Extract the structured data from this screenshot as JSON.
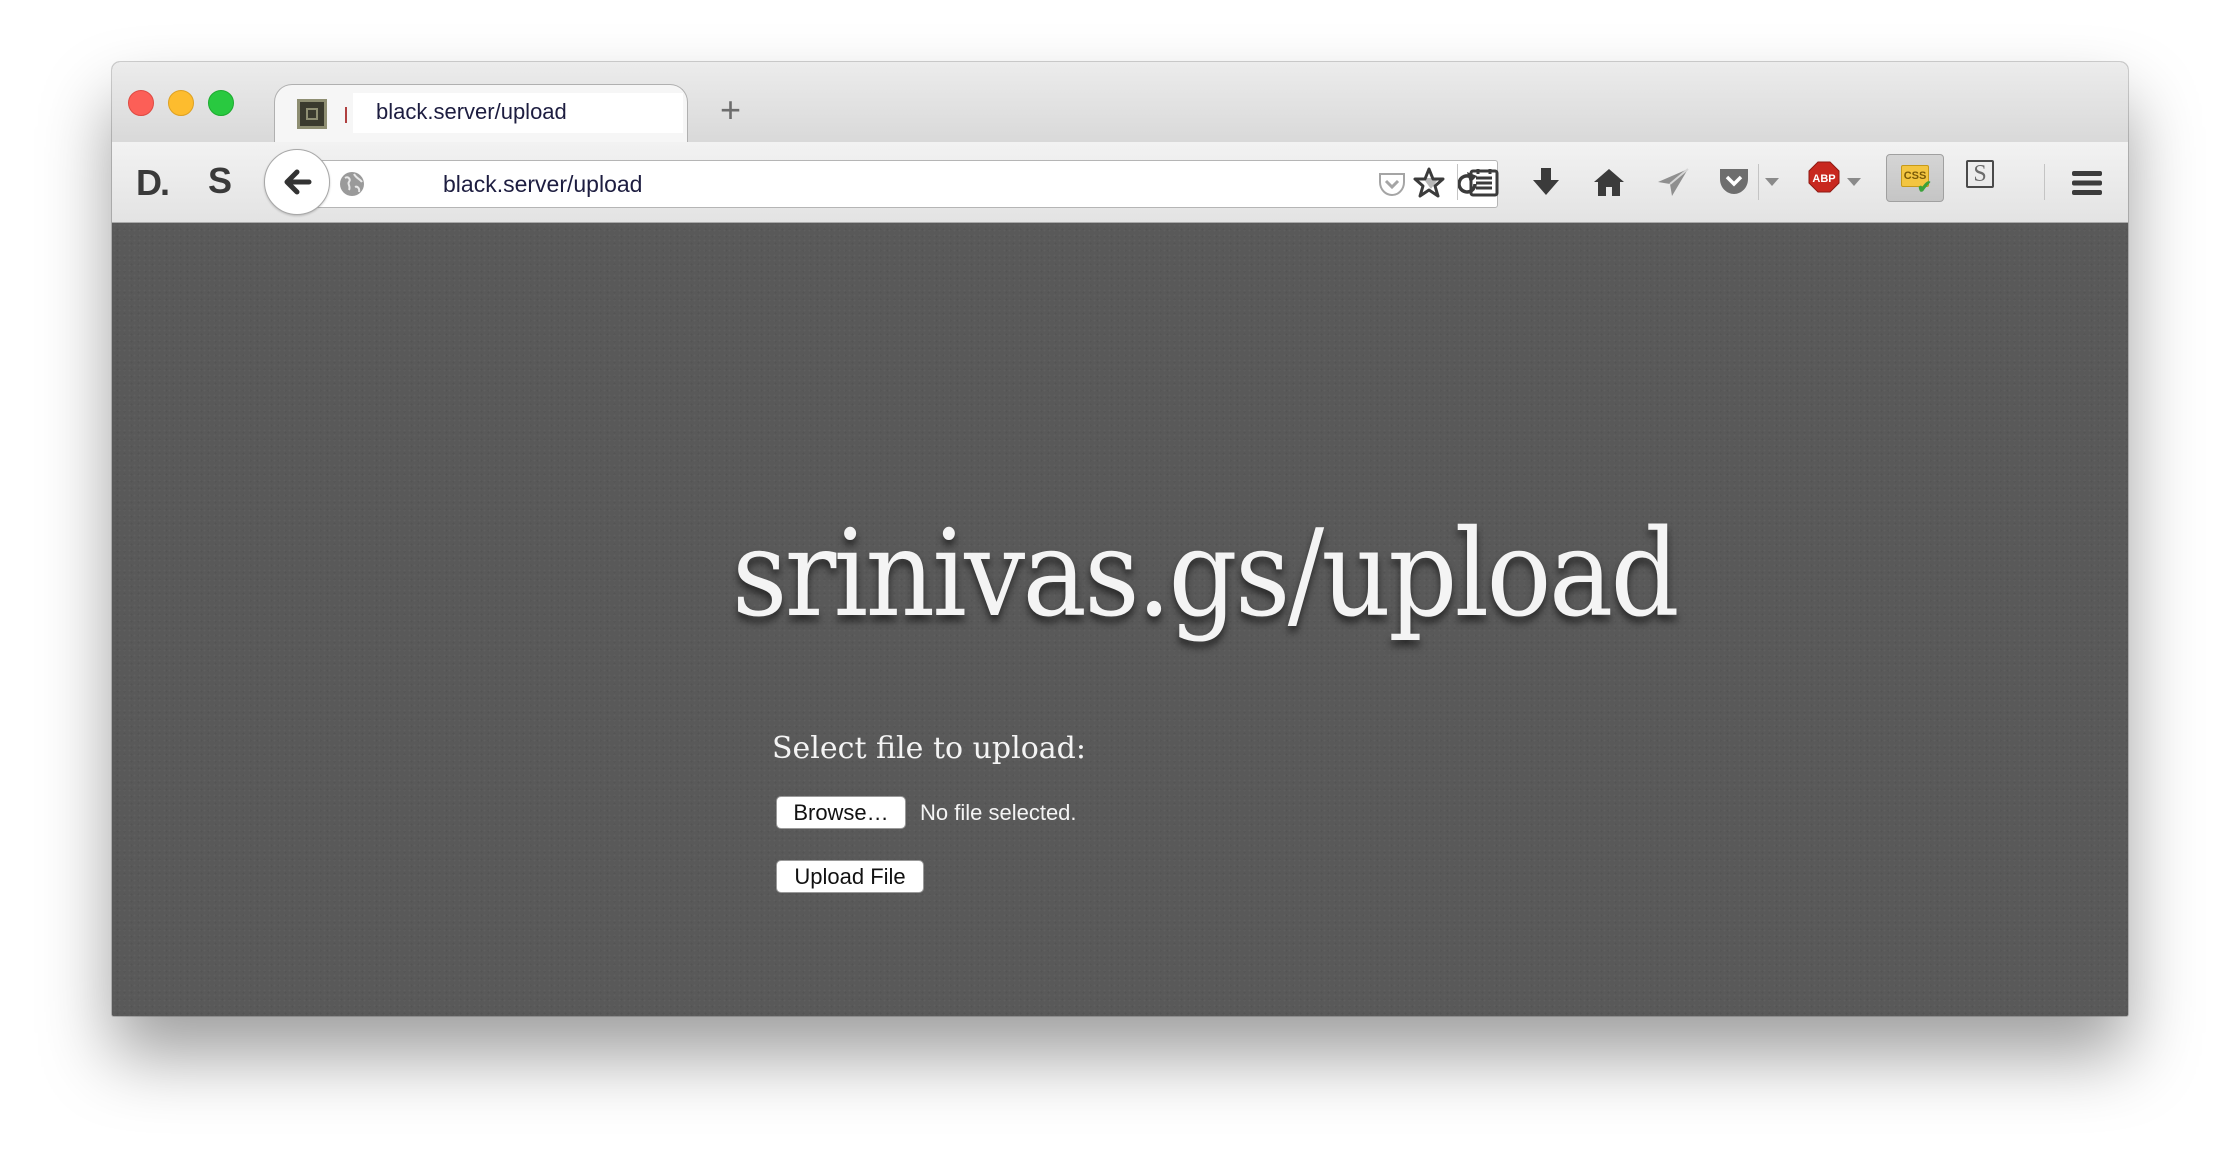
{
  "browser": {
    "tab": {
      "title": "black.server/upload"
    },
    "toolbar": {
      "url": "black.server/upload",
      "icons": [
        "readability-d-icon",
        "stylish-s-icon",
        "back-icon",
        "globe-icon",
        "pocket-icon",
        "reload-icon",
        "bookmark-star-icon",
        "reading-list-icon",
        "download-icon",
        "home-icon",
        "send-icon",
        "pocket-toolbar-icon",
        "adblock-plus-icon",
        "css-reloader-icon",
        "s-extension-icon",
        "hamburger-menu-icon"
      ],
      "abp_label": "ABP",
      "css_label": "CSS"
    },
    "colors": {
      "content_background": "#595959",
      "tabstrip": "#dedede",
      "traffic_red": "#fc5f57",
      "traffic_yellow": "#fdbc2e",
      "traffic_green": "#29c940"
    }
  },
  "page": {
    "title": "srinivas.gs/upload",
    "form": {
      "label": "Select file to upload:",
      "browse_label": "Browse…",
      "file_status": "No file selected.",
      "submit_label": "Upload File"
    }
  }
}
